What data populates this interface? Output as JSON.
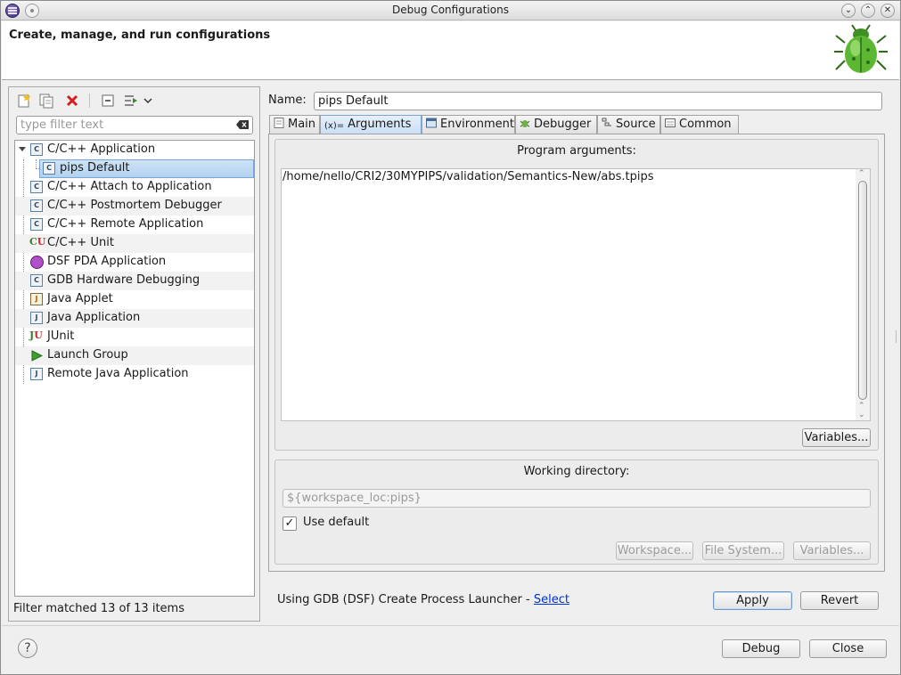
{
  "window": {
    "title": "Debug Configurations"
  },
  "header": {
    "title": "Create, manage, and run configurations"
  },
  "left_panel": {
    "filter_placeholder": "type filter text",
    "tree": [
      {
        "label": "C/C++ Application",
        "icon": "c-app-icon",
        "expanded": true
      },
      {
        "label": "pips Default",
        "icon": "c-app-icon",
        "selected": true
      },
      {
        "label": "C/C++ Attach to Application",
        "icon": "c-app-icon"
      },
      {
        "label": "C/C++ Postmortem Debugger",
        "icon": "c-app-icon"
      },
      {
        "label": "C/C++ Remote Application",
        "icon": "c-app-icon"
      },
      {
        "label": "C/C++ Unit",
        "icon": "cu-unit-icon"
      },
      {
        "label": "DSF PDA Application",
        "icon": "pda-icon"
      },
      {
        "label": "GDB Hardware Debugging",
        "icon": "c-app-icon"
      },
      {
        "label": "Java Applet",
        "icon": "java-applet-icon"
      },
      {
        "label": "Java Application",
        "icon": "java-app-icon"
      },
      {
        "label": "JUnit",
        "icon": "junit-icon"
      },
      {
        "label": "Launch Group",
        "icon": "launch-group-icon"
      },
      {
        "label": "Remote Java Application",
        "icon": "remote-java-icon"
      }
    ],
    "status": "Filter matched 13 of 13 items"
  },
  "config": {
    "name_label": "Name:",
    "name_value": "pips Default",
    "tabs": [
      {
        "label": "Main",
        "icon": "main-tab-icon"
      },
      {
        "label": "Arguments",
        "icon": "arguments-tab-icon",
        "active": true
      },
      {
        "label": "Environment",
        "icon": "environment-tab-icon"
      },
      {
        "label": "Debugger",
        "icon": "debugger-tab-icon"
      },
      {
        "label": "Source",
        "icon": "source-tab-icon"
      },
      {
        "label": "Common",
        "icon": "common-tab-icon"
      }
    ],
    "program_arguments": {
      "title": "Program arguments:",
      "value": "/home/nello/CRI2/30MYPIPS/validation/Semantics-New/abs.tpips",
      "variables_button": "Variables..."
    },
    "working_directory": {
      "title": "Working directory:",
      "value": "${workspace_loc:pips}",
      "use_default_label": "Use default",
      "use_default_checked": true,
      "workspace_button": "Workspace...",
      "filesystem_button": "File System...",
      "variables_button": "Variables..."
    },
    "launcher_text": "Using GDB (DSF) Create Process Launcher - ",
    "launcher_link": "Select",
    "apply_button": "Apply",
    "revert_button": "Revert"
  },
  "footer": {
    "debug_button": "Debug",
    "close_button": "Close"
  },
  "colors": {
    "selection": "#b3d2f0",
    "link": "#0033cc"
  }
}
